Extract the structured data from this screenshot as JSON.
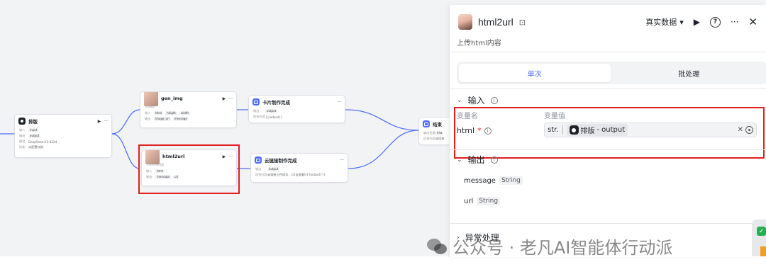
{
  "nodes": {
    "paiban": {
      "title": "排版",
      "rows": [
        [
          "输入",
          "input"
        ],
        [
          "输出",
          "output"
        ],
        [
          "模型",
          "DeepSeek-V3-0324"
        ],
        [
          "技能",
          "未配置技能"
        ]
      ]
    },
    "gen_img": {
      "title": "gen_img",
      "subtitle": "生成图片",
      "in_label": "输入",
      "in_tags": [
        "html",
        "height",
        "width"
      ],
      "out_label": "输出",
      "out_tags": [
        "image_url",
        "message"
      ]
    },
    "card_done": {
      "title": "卡片制作完成",
      "rows": [
        [
          "输出",
          "output"
        ],
        [
          "回答内容",
          "{{output}}"
        ]
      ]
    },
    "html2url": {
      "title": "html2url",
      "subtitle": "上传html内容",
      "in_label": "输入",
      "in_tags": [
        "html"
      ],
      "out_label": "输出",
      "out_tags": [
        "message",
        "url"
      ]
    },
    "cloud_done": {
      "title": "云链接制作完成",
      "rows": [
        [
          "输出",
          "output"
        ],
        [
          "回答内容",
          "云链接上传成功，[点击查看]({{output}})"
        ]
      ]
    },
    "end": {
      "title": "结束",
      "rows": [
        [
          "输出变量",
          "ima"
        ],
        [
          "回答内容",
          "返回变"
        ]
      ]
    }
  },
  "panel": {
    "title": "html2url",
    "data_select": "真实数据",
    "description": "上传html内容",
    "tabs": [
      "单次",
      "批处理"
    ],
    "input": {
      "section": "输入",
      "col_name": "变量名",
      "col_value": "变量值",
      "var_name": "html",
      "required_mark": "*",
      "type_prefix": "str.",
      "ref_node": "排版",
      "ref_sep": "-",
      "ref_var": "output"
    },
    "output": {
      "section": "输出",
      "vars": [
        {
          "name": "message",
          "type": "String"
        },
        {
          "name": "url",
          "type": "String"
        }
      ]
    },
    "exception": {
      "section": "异常处理"
    }
  },
  "watermark": "公众号 · 老凡AI智能体行动派",
  "colors": {
    "accent": "#4d6bfe",
    "highlight": "#e11f1f"
  }
}
